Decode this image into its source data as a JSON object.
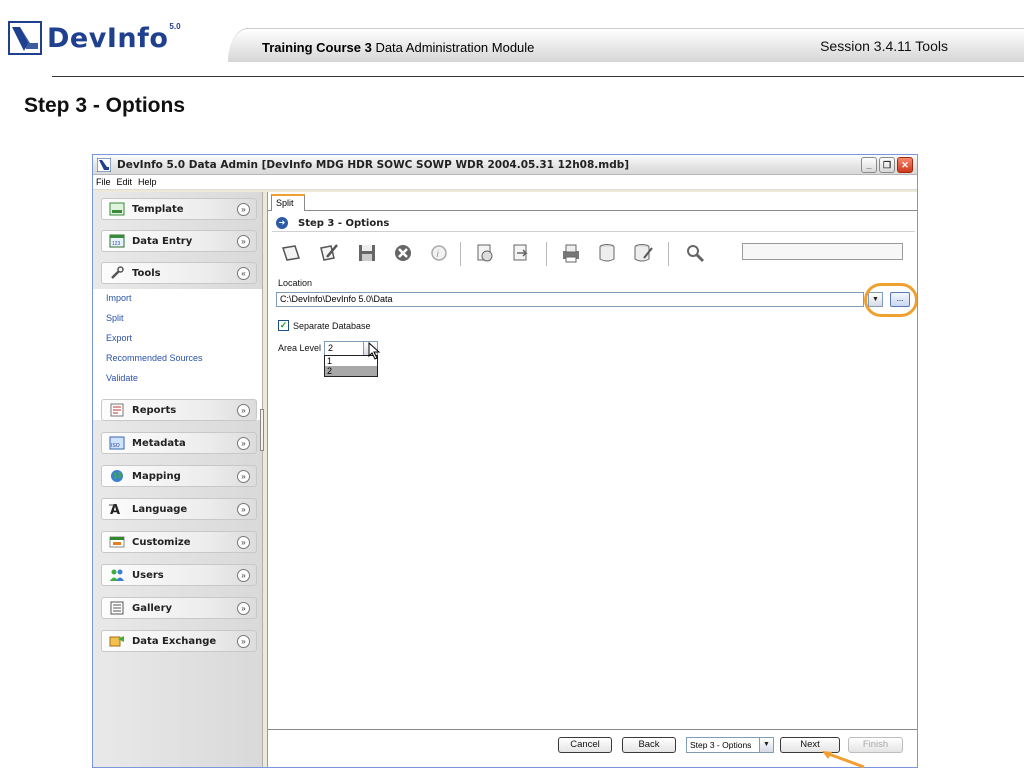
{
  "slide": {
    "logo_text": "DevInfo",
    "logo_version": "5.0",
    "course_bold": "Training Course 3",
    "course_rest": "Data Administration Module",
    "session": "Session 3.4.11 Tools",
    "title": "Step 3 - Options"
  },
  "window": {
    "title": "DevInfo 5.0 Data Admin [DevInfo MDG HDR SOWC SOWP WDR 2004.05.31 12h08.mdb]",
    "controls": {
      "minimize": "_",
      "maximize": "❐",
      "close": "✕"
    }
  },
  "menu": [
    "File",
    "Edit",
    "Help"
  ],
  "sidebar": {
    "groups": [
      {
        "label": "Template",
        "icon": "template-icon",
        "state": "collapsed"
      },
      {
        "label": "Data Entry",
        "icon": "data-entry-icon",
        "state": "collapsed"
      },
      {
        "label": "Tools",
        "icon": "wrench-icon",
        "state": "expanded"
      },
      {
        "label": "Reports",
        "icon": "reports-icon",
        "state": "collapsed"
      },
      {
        "label": "Metadata",
        "icon": "metadata-icon",
        "state": "collapsed"
      },
      {
        "label": "Mapping",
        "icon": "globe-icon",
        "state": "collapsed"
      },
      {
        "label": "Language",
        "icon": "language-icon",
        "state": "collapsed"
      },
      {
        "label": "Customize",
        "icon": "customize-icon",
        "state": "collapsed"
      },
      {
        "label": "Users",
        "icon": "users-icon",
        "state": "collapsed"
      },
      {
        "label": "Gallery",
        "icon": "gallery-icon",
        "state": "collapsed"
      },
      {
        "label": "Data Exchange",
        "icon": "data-exchange-icon",
        "state": "collapsed"
      }
    ],
    "tools_items": [
      "Import",
      "Split",
      "Export",
      "Recommended Sources",
      "Validate"
    ]
  },
  "main": {
    "tab": "Split",
    "step_title": "Step 3 - Options",
    "location_label": "Location",
    "location_value": "C:\\DevInfo\\DevInfo 5.0\\Data",
    "browse_label": "...",
    "separate_db_label": "Separate Database",
    "separate_db_checked": true,
    "area_level_label": "Area Level",
    "area_level_value": "2",
    "area_level_options": [
      "1",
      "2"
    ]
  },
  "footer": {
    "cancel": "Cancel",
    "back": "Back",
    "step_select": "Step 3 - Options",
    "next": "Next",
    "finish": "Finish"
  },
  "colors": {
    "highlight": "#f0a030",
    "brand": "#1f3f8f",
    "link": "#2a52a8"
  }
}
